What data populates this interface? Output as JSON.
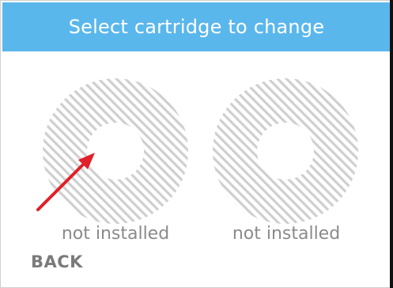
{
  "header": {
    "title": "Select cartridge to change"
  },
  "cartridges": [
    {
      "status": "not installed"
    },
    {
      "status": "not installed"
    }
  ],
  "footer": {
    "back_label": "BACK"
  },
  "colors": {
    "header_bg": "#5ab7ec",
    "ring_stripe": "#cfcfcf",
    "label_text": "#8a8a8a",
    "annotation_arrow": "#e0202a"
  },
  "icons": {
    "annotation": "red-arrow-icon"
  }
}
